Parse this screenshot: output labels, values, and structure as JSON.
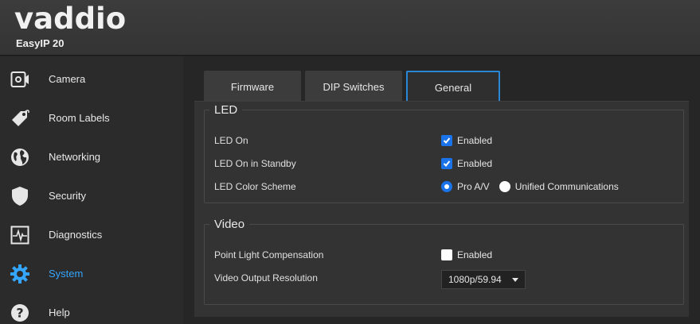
{
  "header": {
    "logo_text": "vaddio",
    "model": "EasyIP 20"
  },
  "sidebar": {
    "items": [
      {
        "label": "Camera",
        "icon": "camera-icon",
        "active": false
      },
      {
        "label": "Room Labels",
        "icon": "tag-icon",
        "active": false
      },
      {
        "label": "Networking",
        "icon": "globe-icon",
        "active": false
      },
      {
        "label": "Security",
        "icon": "shield-icon",
        "active": false
      },
      {
        "label": "Diagnostics",
        "icon": "waveform-icon",
        "active": false
      },
      {
        "label": "System",
        "icon": "gear-icon",
        "active": true
      },
      {
        "label": "Help",
        "icon": "question-icon",
        "active": false
      }
    ],
    "active_color": "#35a6ff"
  },
  "tabs": [
    {
      "label": "Firmware",
      "active": false
    },
    {
      "label": "DIP Switches",
      "active": false
    },
    {
      "label": "General",
      "active": true
    }
  ],
  "led": {
    "legend": "LED",
    "led_on": {
      "label": "LED On",
      "checkbox_label": "Enabled",
      "checked": true
    },
    "led_standby": {
      "label": "LED On in Standby",
      "checkbox_label": "Enabled",
      "checked": true
    },
    "color_scheme": {
      "label": "LED Color Scheme",
      "options": [
        "Pro A/V",
        "Unified Communications"
      ],
      "selected": "Pro A/V"
    }
  },
  "video": {
    "legend": "Video",
    "point_light": {
      "label": "Point Light Compensation",
      "checkbox_label": "Enabled",
      "checked": false
    },
    "output_resolution": {
      "label": "Video Output Resolution",
      "value": "1080p/59.94"
    }
  },
  "colors": {
    "accent": "#1a73e8",
    "tab_highlight": "#2a87d6"
  }
}
